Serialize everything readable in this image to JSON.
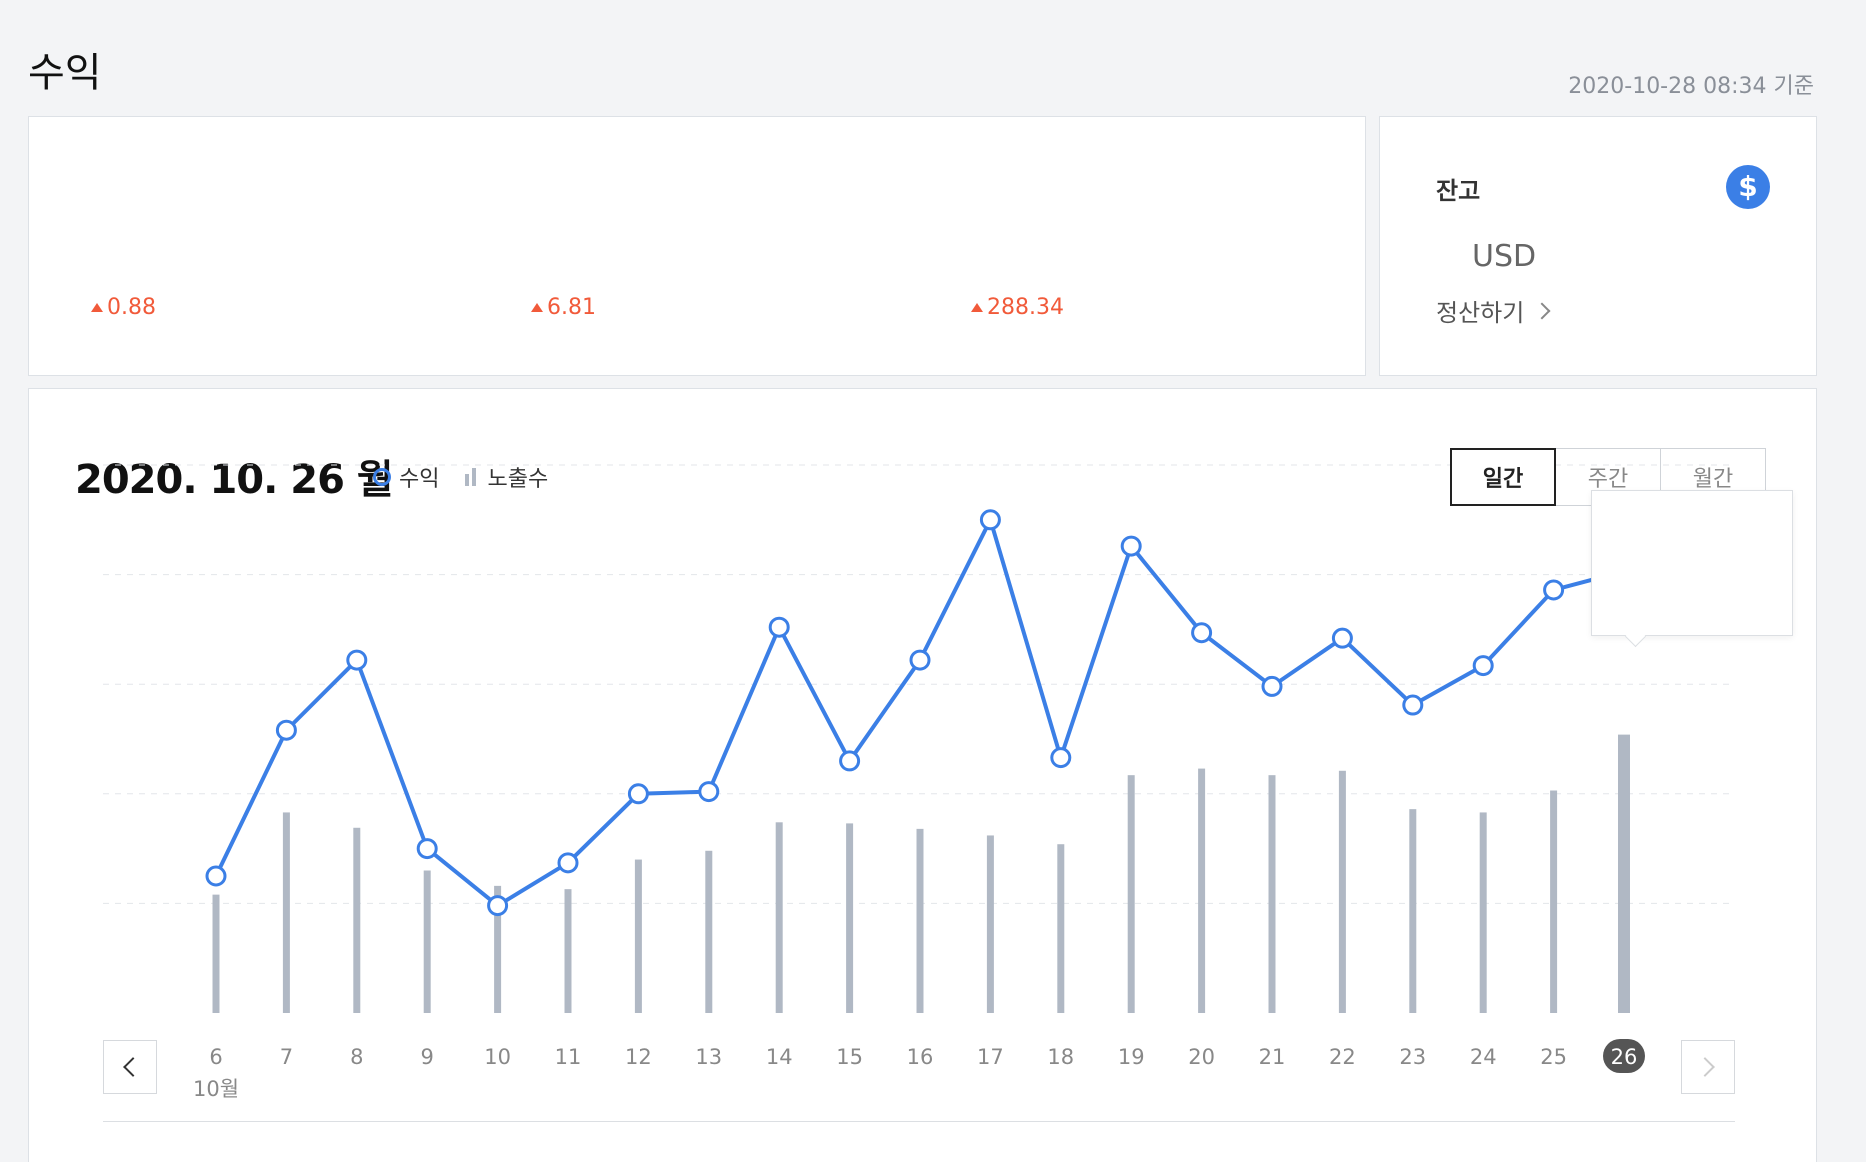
{
  "page": {
    "title": "수익",
    "timestamp": "2020-10-28 08:34 기준"
  },
  "summary": {
    "deltas": [
      "0.88",
      "6.81",
      "288.34"
    ]
  },
  "balance": {
    "label": "잔고",
    "icon": "dollar-icon",
    "icon_glyph": "$",
    "currency": "USD",
    "settle_label": "정산하기"
  },
  "chart_header": {
    "date": "2020. 10. 26 월",
    "legend_revenue": "수익",
    "legend_impressions": "노출수",
    "periods": [
      "일간",
      "주간",
      "월간"
    ],
    "active_period": "일간"
  },
  "colors": {
    "line": "#3b7fe6",
    "bar": "#b0b8c4",
    "up": "#f15a3a"
  },
  "chart_data": {
    "type": "line",
    "x": [
      "6",
      "7",
      "8",
      "9",
      "10",
      "11",
      "12",
      "13",
      "14",
      "15",
      "16",
      "17",
      "18",
      "19",
      "20",
      "21",
      "22",
      "23",
      "24",
      "25",
      "26"
    ],
    "month_label": "10월",
    "selected": "26",
    "series": [
      {
        "name": "수익",
        "type": "line",
        "values": [
          1.25,
          2.58,
          3.22,
          1.5,
          0.98,
          1.37,
          2.0,
          2.02,
          3.52,
          2.3,
          3.22,
          4.5,
          2.33,
          4.26,
          3.47,
          2.98,
          3.42,
          2.81,
          3.17,
          3.86,
          4.03
        ]
      },
      {
        "name": "노출수",
        "type": "bar",
        "values": [
          1.08,
          1.83,
          1.69,
          1.3,
          1.16,
          1.13,
          1.4,
          1.48,
          1.74,
          1.73,
          1.68,
          1.62,
          1.54,
          2.17,
          2.23,
          2.17,
          2.21,
          1.86,
          1.83,
          2.03,
          2.54
        ]
      }
    ],
    "ylim": [
      0,
      5
    ],
    "grid": true
  }
}
